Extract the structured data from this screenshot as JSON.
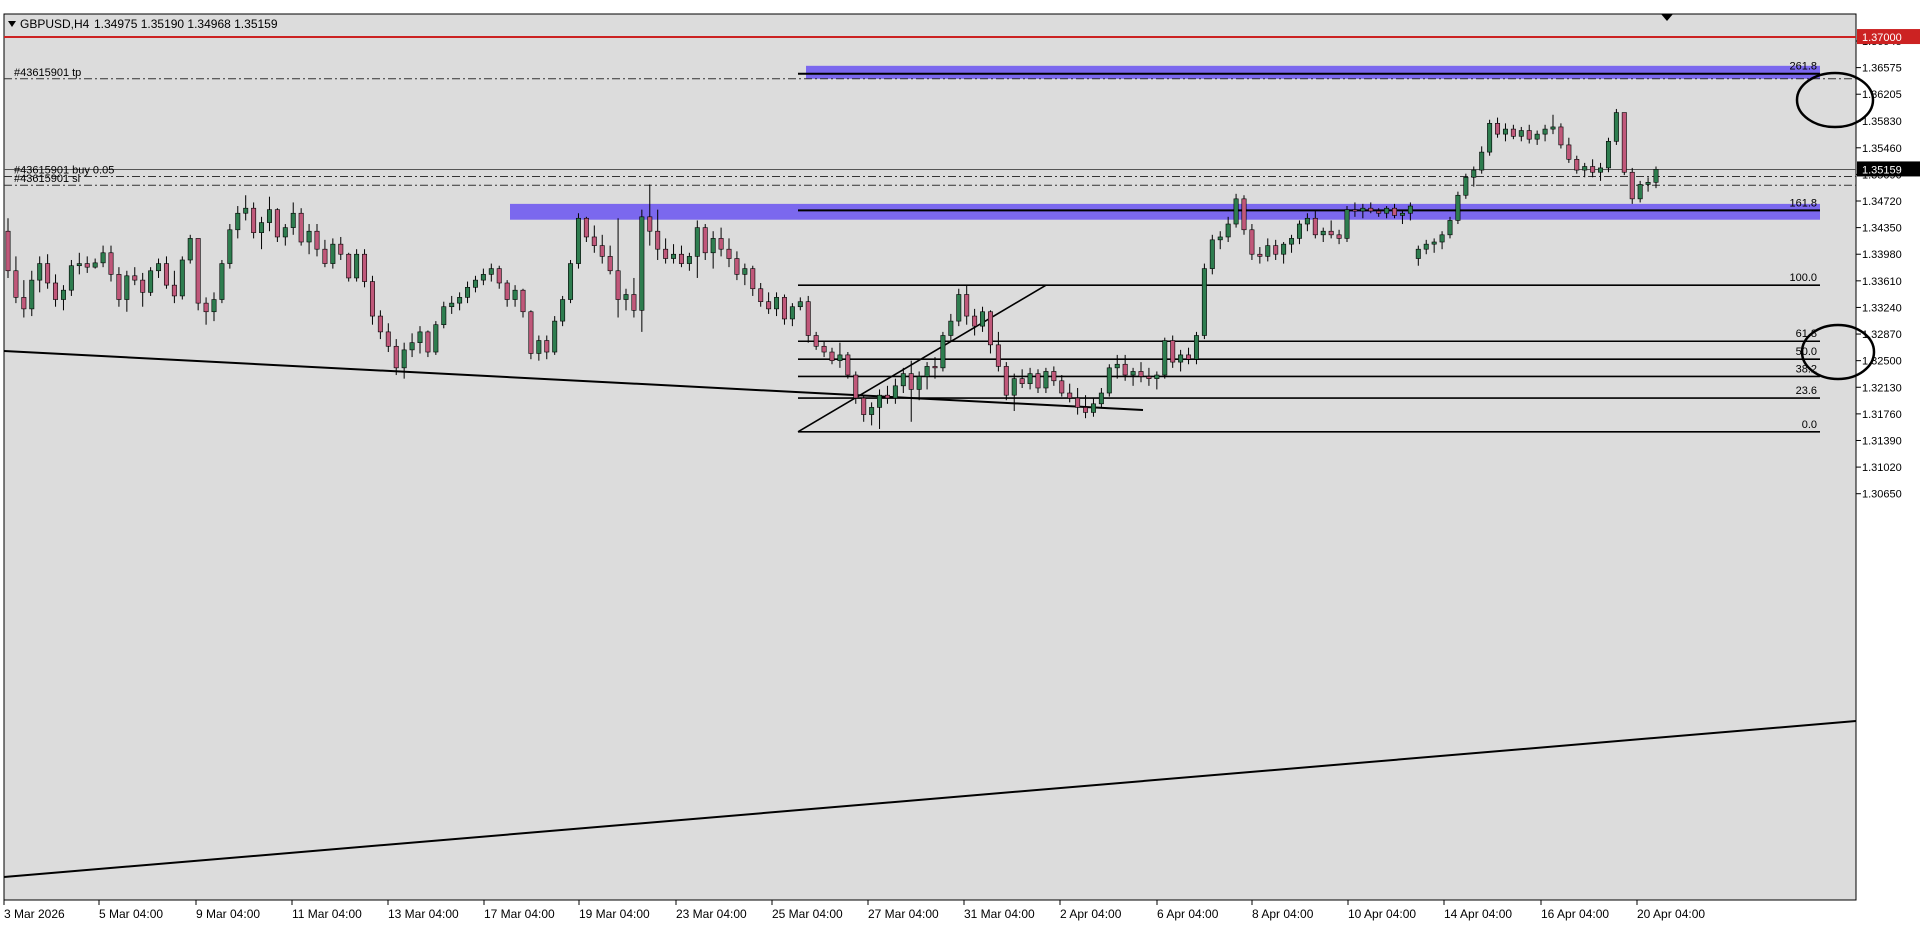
{
  "header": {
    "symbol": "GBPUSD,H4",
    "ohlc": "1.34975 1.35190 1.34968 1.35159"
  },
  "colors": {
    "background": "#dcdcdc",
    "bull": "#2e7d4f",
    "bear": "#c0587a",
    "zone": "#7b68ee",
    "alert_line": "#cc2222",
    "price_label_bg": "#000000",
    "alert_label_bg": "#cc2222"
  },
  "chart_data": {
    "type": "candlestick",
    "symbol": "GBPUSD",
    "timeframe": "H4",
    "current_price": "1.35159",
    "alert_price": "1.37000",
    "y_ticks": [
      "1.36945",
      "1.36575",
      "1.36205",
      "1.35830",
      "1.35460",
      "1.35090",
      "1.34720",
      "1.34350",
      "1.33980",
      "1.33610",
      "1.33240",
      "1.32870",
      "1.32500",
      "1.32130",
      "1.31760",
      "1.31390",
      "1.31020",
      "1.30650"
    ],
    "x_ticks": [
      "3 Mar 2026",
      "5 Mar 04:00",
      "9 Mar 04:00",
      "11 Mar 04:00",
      "13 Mar 04:00",
      "17 Mar 04:00",
      "19 Mar 04:00",
      "23 Mar 04:00",
      "25 Mar 04:00",
      "27 Mar 04:00",
      "31 Mar 04:00",
      "2 Apr 04:00",
      "6 Apr 04:00",
      "8 Apr 04:00",
      "10 Apr 04:00",
      "14 Apr 04:00",
      "16 Apr 04:00",
      "20 Apr 04:00"
    ],
    "order_lines": [
      {
        "label": "#43615901 tp",
        "price": 1.3642
      },
      {
        "label": "#43615901 buy 0.05",
        "price": 1.3506
      },
      {
        "label": "#43615901 sl",
        "price": 1.3494
      }
    ],
    "fib_levels": [
      {
        "label": "100.0",
        "price": 1.3355
      },
      {
        "label": "61.8",
        "price": 1.3277
      },
      {
        "label": "50.0",
        "price": 1.3252
      },
      {
        "label": "38.2",
        "price": 1.3228
      },
      {
        "label": "23.6",
        "price": 1.3198
      },
      {
        "label": "0.0",
        "price": 1.3151
      }
    ],
    "fib_extensions": [
      {
        "label": "261.8",
        "price": 1.3649
      },
      {
        "label": "161.8",
        "price": 1.3459
      }
    ],
    "zones": [
      {
        "from_price": 1.3642,
        "to_price": 1.366
      },
      {
        "from_price": 1.3446,
        "to_price": 1.3468
      }
    ],
    "candles": [
      [
        1.343,
        1.3448,
        1.3365,
        1.3375
      ],
      [
        1.3375,
        1.3395,
        1.333,
        1.3338
      ],
      [
        1.3338,
        1.3362,
        1.331,
        1.3322
      ],
      [
        1.3322,
        1.3375,
        1.3312,
        1.3362
      ],
      [
        1.3362,
        1.3395,
        1.3345,
        1.3385
      ],
      [
        1.3385,
        1.3398,
        1.335,
        1.3358
      ],
      [
        1.3358,
        1.337,
        1.3325,
        1.3335
      ],
      [
        1.3335,
        1.3355,
        1.332,
        1.3348
      ],
      [
        1.3348,
        1.339,
        1.334,
        1.3382
      ],
      [
        1.3382,
        1.34,
        1.337,
        1.3385
      ],
      [
        1.3385,
        1.3395,
        1.3372,
        1.338
      ],
      [
        1.338,
        1.3392,
        1.3378,
        1.3386
      ],
      [
        1.3386,
        1.341,
        1.338,
        1.34
      ],
      [
        1.34,
        1.341,
        1.336,
        1.337
      ],
      [
        1.337,
        1.338,
        1.3325,
        1.3335
      ],
      [
        1.3335,
        1.3375,
        1.3318,
        1.3368
      ],
      [
        1.3368,
        1.338,
        1.3355,
        1.3362
      ],
      [
        1.3362,
        1.3372,
        1.3325,
        1.3345
      ],
      [
        1.3345,
        1.338,
        1.334,
        1.3375
      ],
      [
        1.3375,
        1.3392,
        1.3365,
        1.3385
      ],
      [
        1.3385,
        1.3395,
        1.335,
        1.3355
      ],
      [
        1.3355,
        1.3375,
        1.333,
        1.334
      ],
      [
        1.334,
        1.3395,
        1.3335,
        1.339
      ],
      [
        1.339,
        1.3425,
        1.3385,
        1.342
      ],
      [
        1.342,
        1.3415,
        1.332,
        1.333
      ],
      [
        1.333,
        1.3338,
        1.33,
        1.3318
      ],
      [
        1.3318,
        1.3345,
        1.3305,
        1.3335
      ],
      [
        1.3335,
        1.339,
        1.333,
        1.3385
      ],
      [
        1.3385,
        1.344,
        1.3378,
        1.3432
      ],
      [
        1.3432,
        1.3465,
        1.342,
        1.3455
      ],
      [
        1.3455,
        1.348,
        1.3445,
        1.3462
      ],
      [
        1.3462,
        1.347,
        1.342,
        1.3428
      ],
      [
        1.3428,
        1.345,
        1.3405,
        1.3442
      ],
      [
        1.3442,
        1.3478,
        1.343,
        1.346
      ],
      [
        1.346,
        1.3462,
        1.3415,
        1.3422
      ],
      [
        1.3422,
        1.344,
        1.341,
        1.3435
      ],
      [
        1.3435,
        1.347,
        1.3425,
        1.3455
      ],
      [
        1.3455,
        1.3462,
        1.341,
        1.3415
      ],
      [
        1.3415,
        1.344,
        1.3398,
        1.343
      ],
      [
        1.343,
        1.344,
        1.3395,
        1.3405
      ],
      [
        1.3405,
        1.3418,
        1.338,
        1.3385
      ],
      [
        1.3385,
        1.342,
        1.3378,
        1.3412
      ],
      [
        1.3412,
        1.3422,
        1.339,
        1.3398
      ],
      [
        1.3398,
        1.34,
        1.336,
        1.3365
      ],
      [
        1.3365,
        1.3405,
        1.336,
        1.3398
      ],
      [
        1.3398,
        1.3405,
        1.3352,
        1.336
      ],
      [
        1.336,
        1.3368,
        1.33,
        1.3312
      ],
      [
        1.3312,
        1.332,
        1.328,
        1.329
      ],
      [
        1.329,
        1.3302,
        1.3262,
        1.327
      ],
      [
        1.327,
        1.328,
        1.323,
        1.324
      ],
      [
        1.324,
        1.3275,
        1.3225,
        1.3265
      ],
      [
        1.3265,
        1.3288,
        1.3255,
        1.3275
      ],
      [
        1.3275,
        1.3298,
        1.326,
        1.329
      ],
      [
        1.329,
        1.3292,
        1.3255,
        1.3262
      ],
      [
        1.3262,
        1.3305,
        1.3258,
        1.33
      ],
      [
        1.33,
        1.3332,
        1.3295,
        1.3325
      ],
      [
        1.3325,
        1.334,
        1.3315,
        1.333
      ],
      [
        1.333,
        1.3345,
        1.332,
        1.3338
      ],
      [
        1.3338,
        1.336,
        1.333,
        1.3352
      ],
      [
        1.3352,
        1.3368,
        1.3345,
        1.3362
      ],
      [
        1.3362,
        1.3378,
        1.3355,
        1.337
      ],
      [
        1.337,
        1.3385,
        1.336,
        1.3378
      ],
      [
        1.3378,
        1.3382,
        1.335,
        1.3358
      ],
      [
        1.3358,
        1.3362,
        1.3325,
        1.3335
      ],
      [
        1.3335,
        1.3355,
        1.3325,
        1.3348
      ],
      [
        1.3348,
        1.335,
        1.331,
        1.3318
      ],
      [
        1.3318,
        1.332,
        1.3252,
        1.326
      ],
      [
        1.326,
        1.3285,
        1.325,
        1.3278
      ],
      [
        1.3278,
        1.3285,
        1.3252,
        1.3262
      ],
      [
        1.3262,
        1.3312,
        1.3258,
        1.3305
      ],
      [
        1.3305,
        1.334,
        1.3298,
        1.3335
      ],
      [
        1.3335,
        1.339,
        1.333,
        1.3385
      ],
      [
        1.3385,
        1.3455,
        1.3378,
        1.3448
      ],
      [
        1.3448,
        1.345,
        1.3415,
        1.3422
      ],
      [
        1.3422,
        1.3438,
        1.34,
        1.341
      ],
      [
        1.341,
        1.3425,
        1.3385,
        1.3395
      ],
      [
        1.3395,
        1.341,
        1.337,
        1.3375
      ],
      [
        1.3375,
        1.3448,
        1.331,
        1.3335
      ],
      [
        1.3335,
        1.335,
        1.332,
        1.3342
      ],
      [
        1.3342,
        1.3365,
        1.331,
        1.332
      ],
      [
        1.332,
        1.346,
        1.329,
        1.345
      ],
      [
        1.345,
        1.3495,
        1.341,
        1.343
      ],
      [
        1.343,
        1.346,
        1.339,
        1.3405
      ],
      [
        1.3405,
        1.342,
        1.3385,
        1.3392
      ],
      [
        1.3392,
        1.3412,
        1.3385,
        1.3398
      ],
      [
        1.3398,
        1.341,
        1.338,
        1.3385
      ],
      [
        1.3385,
        1.34,
        1.3375,
        1.3395
      ],
      [
        1.3395,
        1.3445,
        1.3365,
        1.3435
      ],
      [
        1.3435,
        1.344,
        1.339,
        1.34
      ],
      [
        1.34,
        1.343,
        1.3378,
        1.342
      ],
      [
        1.342,
        1.3435,
        1.3395,
        1.3405
      ],
      [
        1.3405,
        1.342,
        1.338,
        1.3392
      ],
      [
        1.3392,
        1.3402,
        1.3362,
        1.337
      ],
      [
        1.337,
        1.3385,
        1.3355,
        1.3378
      ],
      [
        1.3378,
        1.3382,
        1.334,
        1.335
      ],
      [
        1.335,
        1.3358,
        1.3325,
        1.3332
      ],
      [
        1.3332,
        1.3345,
        1.3315,
        1.3322
      ],
      [
        1.3322,
        1.3345,
        1.3312,
        1.3338
      ],
      [
        1.3338,
        1.3342,
        1.33,
        1.3308
      ],
      [
        1.3308,
        1.333,
        1.3298,
        1.3325
      ],
      [
        1.3325,
        1.3338,
        1.332,
        1.3332
      ],
      [
        1.3332,
        1.334,
        1.3275,
        1.3285
      ],
      [
        1.3285,
        1.329,
        1.3265,
        1.327
      ],
      [
        1.327,
        1.3278,
        1.3255,
        1.3262
      ],
      [
        1.3262,
        1.3268,
        1.3245,
        1.325
      ],
      [
        1.325,
        1.3275,
        1.324,
        1.3258
      ],
      [
        1.3258,
        1.3262,
        1.3225,
        1.323
      ],
      [
        1.323,
        1.3235,
        1.319,
        1.3198
      ],
      [
        1.3198,
        1.3202,
        1.3165,
        1.3175
      ],
      [
        1.3175,
        1.3192,
        1.316,
        1.3185
      ],
      [
        1.3185,
        1.321,
        1.3155,
        1.3202
      ],
      [
        1.3202,
        1.3215,
        1.319,
        1.3198
      ],
      [
        1.3198,
        1.3225,
        1.319,
        1.3215
      ],
      [
        1.3215,
        1.324,
        1.3205,
        1.3232
      ],
      [
        1.3232,
        1.325,
        1.3165,
        1.321
      ],
      [
        1.321,
        1.3235,
        1.3195,
        1.3228
      ],
      [
        1.3228,
        1.3248,
        1.321,
        1.3242
      ],
      [
        1.3242,
        1.3255,
        1.3225,
        1.324
      ],
      [
        1.324,
        1.329,
        1.3235,
        1.3285
      ],
      [
        1.3285,
        1.3315,
        1.3278,
        1.3305
      ],
      [
        1.3305,
        1.335,
        1.3298,
        1.3342
      ],
      [
        1.3342,
        1.3355,
        1.33,
        1.3312
      ],
      [
        1.3312,
        1.3322,
        1.3285,
        1.3298
      ],
      [
        1.3298,
        1.3325,
        1.329,
        1.3318
      ],
      [
        1.3318,
        1.332,
        1.326,
        1.3272
      ],
      [
        1.3272,
        1.329,
        1.3235,
        1.3242
      ],
      [
        1.3242,
        1.3248,
        1.3195,
        1.3202
      ],
      [
        1.3202,
        1.3232,
        1.318,
        1.3225
      ],
      [
        1.3225,
        1.3238,
        1.3212,
        1.3218
      ],
      [
        1.3218,
        1.324,
        1.321,
        1.3232
      ],
      [
        1.3232,
        1.3238,
        1.3205,
        1.3212
      ],
      [
        1.3212,
        1.324,
        1.3205,
        1.3235
      ],
      [
        1.3235,
        1.3242,
        1.3215,
        1.3222
      ],
      [
        1.3222,
        1.323,
        1.32,
        1.3205
      ],
      [
        1.3205,
        1.3218,
        1.3192,
        1.3198
      ],
      [
        1.3198,
        1.3212,
        1.3175,
        1.3185
      ],
      [
        1.3185,
        1.3202,
        1.317,
        1.3178
      ],
      [
        1.3178,
        1.3198,
        1.3172,
        1.319
      ],
      [
        1.319,
        1.3212,
        1.3185,
        1.3205
      ],
      [
        1.3205,
        1.3245,
        1.32,
        1.324
      ],
      [
        1.324,
        1.3258,
        1.3225,
        1.3245
      ],
      [
        1.3245,
        1.3258,
        1.3222,
        1.323
      ],
      [
        1.323,
        1.324,
        1.3215,
        1.3235
      ],
      [
        1.3235,
        1.3248,
        1.322,
        1.3228
      ],
      [
        1.3228,
        1.324,
        1.3215,
        1.3225
      ],
      [
        1.3225,
        1.3235,
        1.321,
        1.323
      ],
      [
        1.323,
        1.3282,
        1.3225,
        1.3278
      ],
      [
        1.3278,
        1.3285,
        1.324,
        1.3248
      ],
      [
        1.3248,
        1.3265,
        1.3235,
        1.3258
      ],
      [
        1.3258,
        1.3268,
        1.3245,
        1.3252
      ],
      [
        1.3252,
        1.329,
        1.3245,
        1.3285
      ],
      [
        1.3285,
        1.3385,
        1.328,
        1.3378
      ],
      [
        1.3378,
        1.3425,
        1.337,
        1.3418
      ],
      [
        1.3418,
        1.343,
        1.3405,
        1.3422
      ],
      [
        1.3422,
        1.345,
        1.3415,
        1.344
      ],
      [
        1.344,
        1.3482,
        1.3435,
        1.3475
      ],
      [
        1.3475,
        1.348,
        1.3425,
        1.3432
      ],
      [
        1.3432,
        1.344,
        1.339,
        1.3398
      ],
      [
        1.3398,
        1.3408,
        1.3385,
        1.3395
      ],
      [
        1.3395,
        1.342,
        1.3388,
        1.341
      ],
      [
        1.341,
        1.3418,
        1.339,
        1.3398
      ],
      [
        1.3398,
        1.3415,
        1.3385,
        1.3412
      ],
      [
        1.3412,
        1.3425,
        1.34,
        1.342
      ],
      [
        1.342,
        1.3445,
        1.3412,
        1.344
      ],
      [
        1.344,
        1.3455,
        1.343,
        1.3448
      ],
      [
        1.3448,
        1.3458,
        1.342,
        1.3425
      ],
      [
        1.3425,
        1.3435,
        1.3415,
        1.343
      ],
      [
        1.343,
        1.3445,
        1.342,
        1.3425
      ],
      [
        1.3425,
        1.3432,
        1.3412,
        1.342
      ],
      [
        1.342,
        1.3465,
        1.3415,
        1.346
      ],
      [
        1.346,
        1.347,
        1.345,
        1.3458
      ],
      [
        1.3458,
        1.3468,
        1.3448,
        1.3462
      ],
      [
        1.3462,
        1.347,
        1.3455,
        1.3458
      ],
      [
        1.3458,
        1.3462,
        1.345,
        1.3455
      ],
      [
        1.3455,
        1.3465,
        1.3448,
        1.3462
      ],
      [
        1.3462,
        1.3468,
        1.3448,
        1.3452
      ],
      [
        1.3452,
        1.346,
        1.344,
        1.3455
      ],
      [
        1.3455,
        1.347,
        1.3445,
        1.3465
      ],
      [
        1.3392,
        1.341,
        1.3382,
        1.3405
      ],
      [
        1.3405,
        1.3418,
        1.3398,
        1.3412
      ],
      [
        1.3412,
        1.342,
        1.34,
        1.3415
      ],
      [
        1.3415,
        1.343,
        1.3405,
        1.3425
      ],
      [
        1.3425,
        1.345,
        1.342,
        1.3445
      ],
      [
        1.3445,
        1.3485,
        1.344,
        1.348
      ],
      [
        1.348,
        1.351,
        1.3475,
        1.3505
      ],
      [
        1.3505,
        1.352,
        1.3492,
        1.3515
      ],
      [
        1.3515,
        1.3548,
        1.351,
        1.354
      ],
      [
        1.354,
        1.3585,
        1.3535,
        1.358
      ],
      [
        1.358,
        1.3588,
        1.356,
        1.3565
      ],
      [
        1.3565,
        1.358,
        1.3555,
        1.3572
      ],
      [
        1.3572,
        1.3578,
        1.3558,
        1.3562
      ],
      [
        1.3562,
        1.3575,
        1.3555,
        1.357
      ],
      [
        1.357,
        1.3578,
        1.3552,
        1.3558
      ],
      [
        1.3558,
        1.357,
        1.355,
        1.3565
      ],
      [
        1.3565,
        1.3578,
        1.3555,
        1.3572
      ],
      [
        1.3572,
        1.3592,
        1.3565,
        1.3575
      ],
      [
        1.3575,
        1.358,
        1.3545,
        1.355
      ],
      [
        1.355,
        1.356,
        1.3525,
        1.353
      ],
      [
        1.353,
        1.3535,
        1.351,
        1.3515
      ],
      [
        1.3515,
        1.3525,
        1.3505,
        1.352
      ],
      [
        1.352,
        1.353,
        1.3505,
        1.3512
      ],
      [
        1.3512,
        1.3525,
        1.35,
        1.3518
      ],
      [
        1.3518,
        1.356,
        1.3512,
        1.3555
      ],
      [
        1.3555,
        1.36,
        1.355,
        1.3595
      ],
      [
        1.3595,
        1.3575,
        1.3508,
        1.3512
      ],
      [
        1.3512,
        1.3518,
        1.3468,
        1.3475
      ],
      [
        1.3475,
        1.35,
        1.347,
        1.3495
      ],
      [
        1.3495,
        1.3505,
        1.3485,
        1.3498
      ],
      [
        1.3498,
        1.352,
        1.349,
        1.3516
      ]
    ]
  }
}
